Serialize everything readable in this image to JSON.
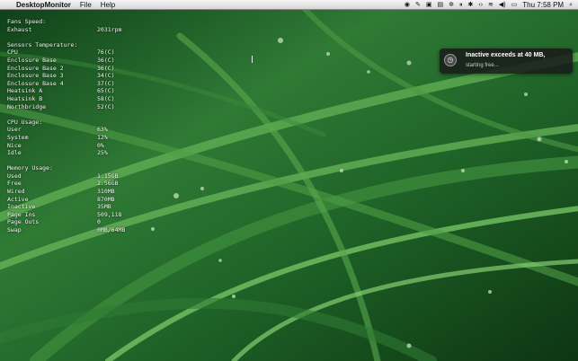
{
  "menubar": {
    "apple_glyph": "",
    "app_name": "DesktopMonitor",
    "menus": [
      "File",
      "Help"
    ],
    "status_icons": [
      "app-status-icon",
      "script-icon",
      "window-icon",
      "battery-monitor-icon",
      "gear-icon",
      "pause-icon",
      "bluetooth-icon",
      "code-icon",
      "wifi-icon",
      "volume-icon",
      "battery-icon"
    ],
    "clock": "Thu 7:58 PM"
  },
  "monitor": {
    "fans": {
      "header": "Fans Speed:",
      "rows": [
        {
          "label": "Exhaust",
          "value": "2031rpm"
        }
      ]
    },
    "sensors": {
      "header": "Sensors Temperature:",
      "rows": [
        {
          "label": "CPU",
          "value": "76(C)"
        },
        {
          "label": "Enclosure Base",
          "value": "36(C)"
        },
        {
          "label": "Enclosure Base 2",
          "value": "36(C)"
        },
        {
          "label": "Enclosure Base 3",
          "value": "34(C)"
        },
        {
          "label": "Enclosure Base 4",
          "value": "37(C)"
        },
        {
          "label": "Heatsink A",
          "value": "65(C)"
        },
        {
          "label": "Heatsink B",
          "value": "58(C)"
        },
        {
          "label": "Northbridge",
          "value": "52(C)"
        }
      ]
    },
    "cpu": {
      "header": "CPU Usage:",
      "rows": [
        {
          "label": "User",
          "value": "63%"
        },
        {
          "label": "System",
          "value": "12%"
        },
        {
          "label": "Nice",
          "value": "0%"
        },
        {
          "label": "Idle",
          "value": "25%"
        }
      ]
    },
    "memory": {
      "header": "Memory Usage:",
      "rows": [
        {
          "label": "Used",
          "value": "1.15GB"
        },
        {
          "label": "Free",
          "value": "2.56GB"
        },
        {
          "label": "Wired",
          "value": "310MB"
        },
        {
          "label": "Active",
          "value": "870MB"
        },
        {
          "label": "Inactive",
          "value": "35MB"
        },
        {
          "label": "Page Ins",
          "value": "509,118"
        },
        {
          "label": "Page Outs",
          "value": "0"
        },
        {
          "label": "Swap",
          "value": "0MB/64MB"
        }
      ]
    }
  },
  "notification": {
    "title": "Inactive exceeds at 40 MB,",
    "body": "starting free..."
  }
}
